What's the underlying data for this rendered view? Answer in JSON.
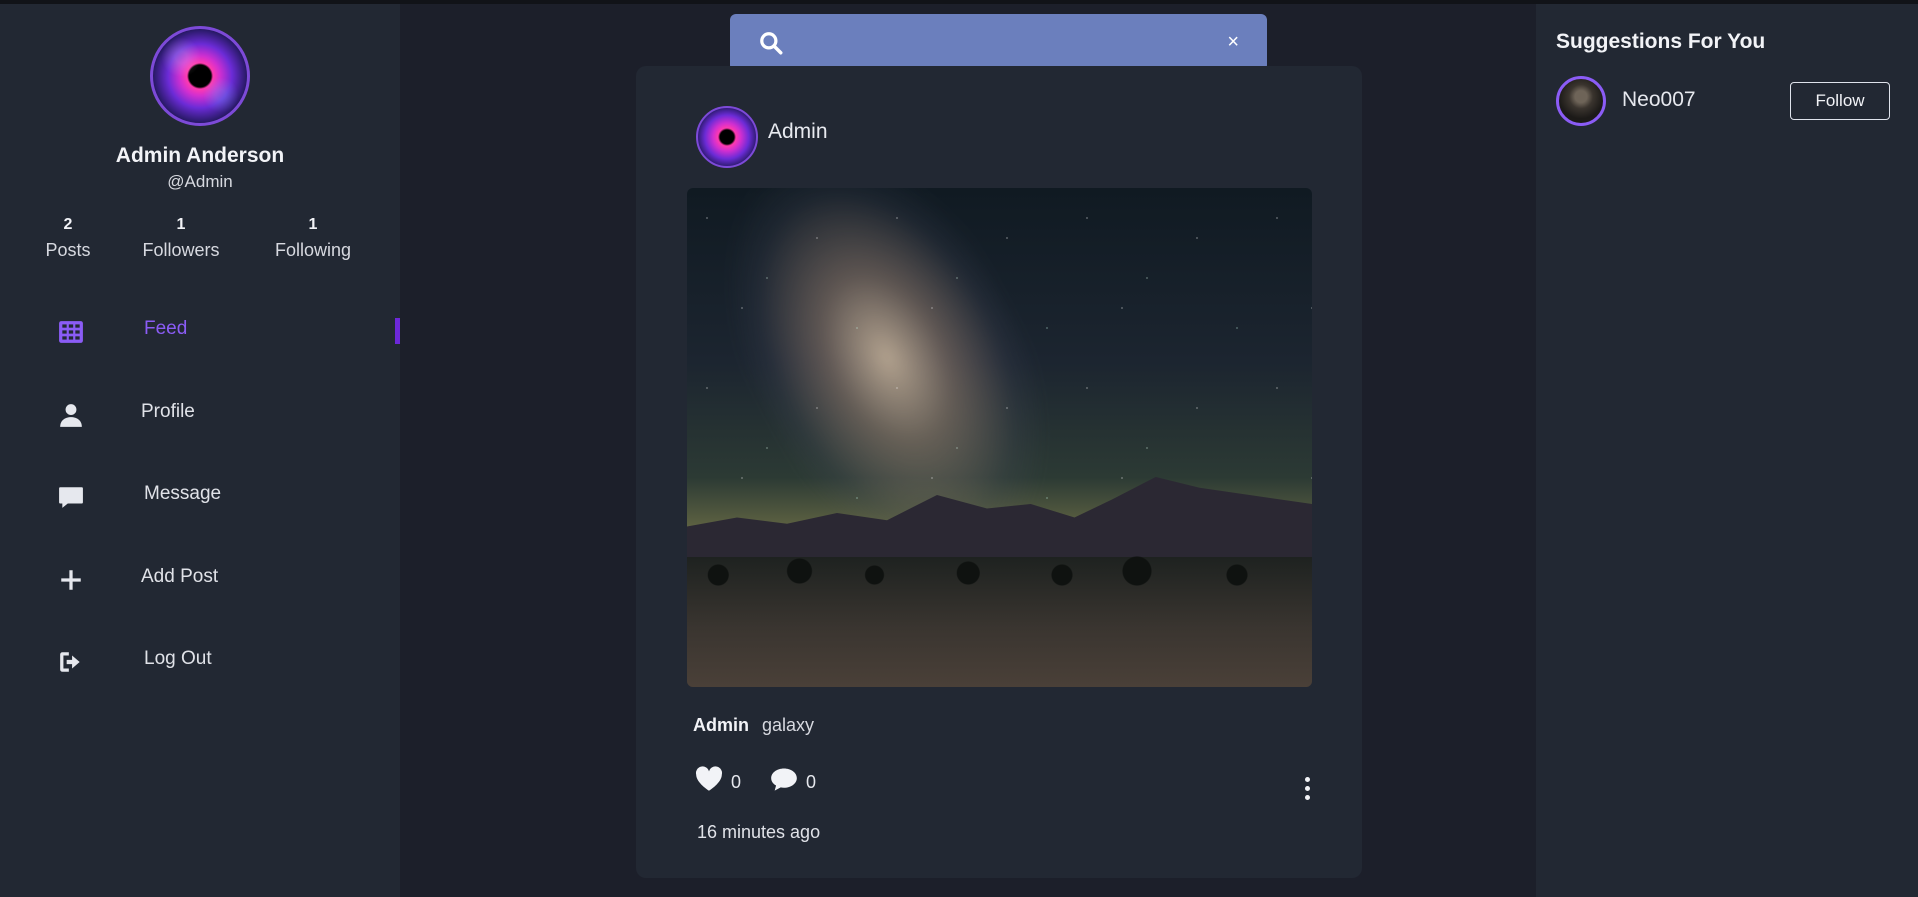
{
  "profile": {
    "name": "Admin Anderson",
    "handle": "@Admin",
    "stats": [
      {
        "value": "2",
        "label": "Posts"
      },
      {
        "value": "1",
        "label": "Followers"
      },
      {
        "value": "1",
        "label": "Following"
      }
    ]
  },
  "nav": {
    "items": [
      {
        "label": "Feed",
        "icon": "grid-icon",
        "active": true
      },
      {
        "label": "Profile",
        "icon": "user-icon",
        "active": false
      },
      {
        "label": "Message",
        "icon": "chat-bubble-icon",
        "active": false
      },
      {
        "label": "Add Post",
        "icon": "plus-icon",
        "active": false
      },
      {
        "label": "Log Out",
        "icon": "logout-icon",
        "active": false
      }
    ]
  },
  "search": {
    "value": "",
    "placeholder": "",
    "clear_glyph": "×"
  },
  "post": {
    "username": "Admin",
    "caption_author": "Admin",
    "caption_text": "galaxy",
    "likes": "0",
    "comments": "0",
    "timestamp": "16 minutes ago"
  },
  "suggestions": {
    "title": "Suggestions For You",
    "items": [
      {
        "name": "Neo007",
        "button": "Follow"
      }
    ]
  },
  "colors": {
    "accent": "#8b5cf6",
    "sidebar_bg": "#222833",
    "page_bg": "#1c1f2a",
    "search_bg": "#6b7fbd"
  }
}
